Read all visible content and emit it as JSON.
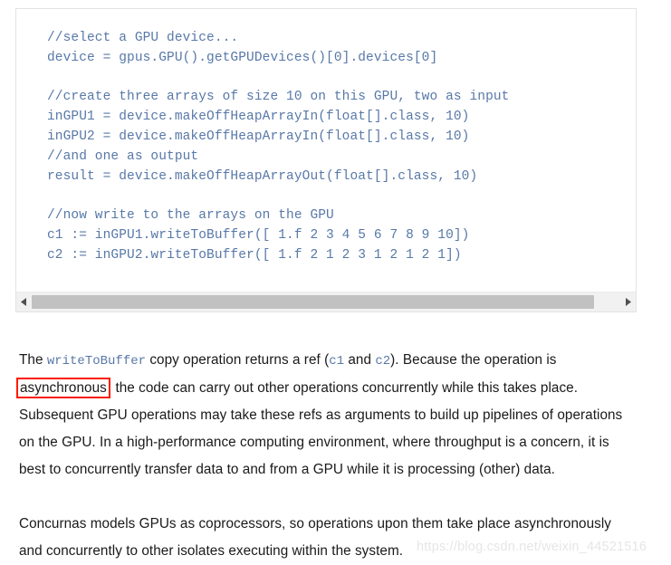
{
  "code_block": {
    "language_style": "concurnas",
    "text_color": "#5878a8",
    "border_color": "#e3e3e3",
    "lines": [
      "//select a GPU device...",
      "device = gpus.GPU().getGPUDevices()[0].devices[0]",
      "",
      "//create three arrays of size 10 on this GPU, two as input",
      "inGPU1 = device.makeOffHeapArrayIn(float[].class, 10)",
      "inGPU2 = device.makeOffHeapArrayIn(float[].class, 10)",
      "//and one as output",
      "result = device.makeOffHeapArrayOut(float[].class, 10)",
      "",
      "//now write to the arrays on the GPU",
      "c1 := inGPU1.writeToBuffer([ 1.f 2 3 4 5 6 7 8 9 10])",
      "c2 := inGPU2.writeToBuffer([ 1.f 2 1 2 3 1 2 1 2 1])"
    ],
    "full_text": "//select a GPU device...\ndevice = gpus.GPU().getGPUDevices()[0].devices[0]\n\n//create three arrays of size 10 on this GPU, two as input\ninGPU1 = device.makeOffHeapArrayIn(float[].class, 10)\ninGPU2 = device.makeOffHeapArrayIn(float[].class, 10)\n//and one as output\nresult = device.makeOffHeapArrayOut(float[].class, 10)\n\n//now write to the arrays on the GPU\nc1 := inGPU1.writeToBuffer([ 1.f 2 3 4 5 6 7 8 9 10])\nc2 := inGPU2.writeToBuffer([ 1.f 2 1 2 3 1 2 1 2 1])",
    "scrollbar": {
      "left_arrow": "triangle-left-icon",
      "right_arrow": "triangle-right-icon",
      "thumb_width_percent": 95,
      "thumb_color": "#c1c1c1",
      "track_color": "#f1f1f1"
    }
  },
  "paragraph_1": {
    "seg_1": "The ",
    "code_1": "writeToBuffer",
    "seg_2": " copy operation returns a ref (",
    "code_2": "c1",
    "seg_3": " and ",
    "code_3": "c2",
    "seg_4": "). Because the operation is ",
    "highlight": "asynchronous",
    "highlight_color": "#ff1a00",
    "seg_5": ", the code can carry out other operations concurrently while this takes place. Subsequent GPU operations may take these refs as arguments to build up pipelines of operations on the GPU. In a high-performance computing environment, where throughput is a concern, it is best to concurrently transfer data to and from a GPU while it is processing (other) data."
  },
  "paragraph_2": {
    "text": "Concurnas models GPUs as coprocessors, so operations upon them take place asynchronously and concurrently to other isolates executing within the system."
  },
  "watermark": {
    "text": "https://blog.csdn.net/weixin_44521516"
  }
}
